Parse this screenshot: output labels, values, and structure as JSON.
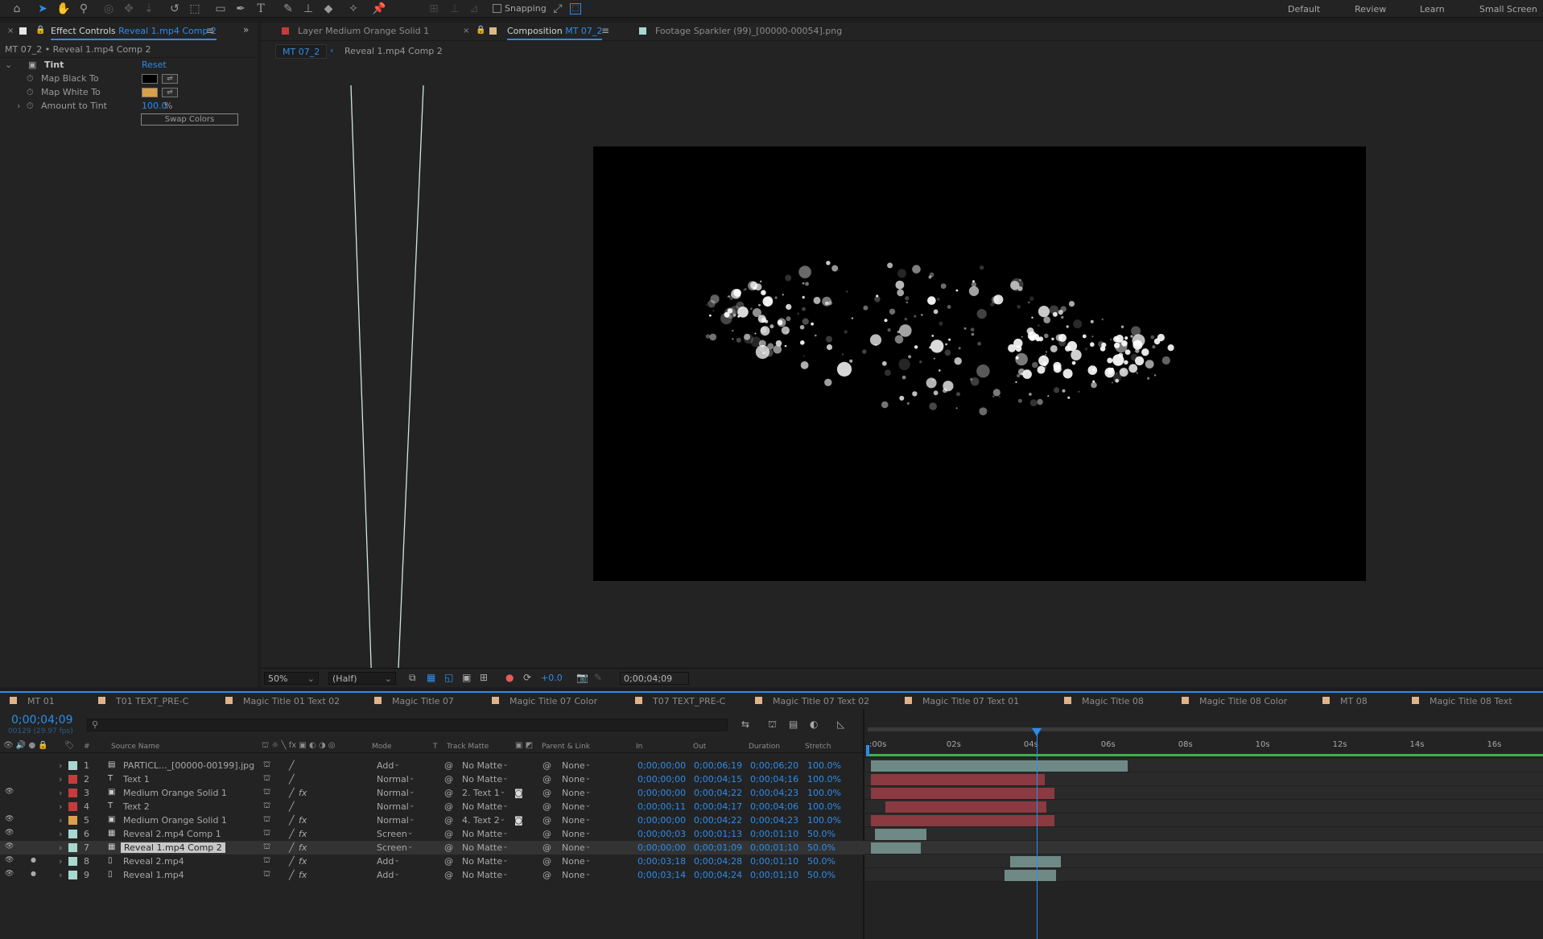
{
  "toolbar": {
    "icons": [
      "home-icon",
      "selection-tool-icon",
      "hand-tool-icon",
      "zoom-tool-icon",
      "orbit-camera-icon",
      "pan-camera-icon",
      "dolly-camera-icon",
      "rotation-tool-icon",
      "pan-behind-icon",
      "rectangle-tool-icon",
      "pen-tool-icon",
      "type-tool-icon",
      "brush-tool-icon",
      "clone-stamp-icon",
      "eraser-icon",
      "roto-brush-icon",
      "puppet-pin-icon"
    ],
    "snapping_label": "Snapping",
    "workspaces": [
      "Default",
      "Review",
      "Learn",
      "Small Screen"
    ]
  },
  "effect_controls": {
    "tab_prefix": "Effect Controls",
    "tab_layer": "Reveal 1.mp4 Comp 2",
    "breadcrumb": "MT 07_2 • Reveal 1.mp4 Comp 2",
    "effect_name": "Tint",
    "reset_label": "Reset",
    "props": [
      {
        "name": "Map Black To",
        "color": "#000000"
      },
      {
        "name": "Map White To",
        "color": "#d9a04c"
      }
    ],
    "amount_label": "Amount to Tint",
    "amount_value": "100.0",
    "amount_unit": "%",
    "swap_label": "Swap Colors"
  },
  "viewer_tabs": {
    "layer_prefix": "Layer",
    "layer_name": "Medium Orange Solid 1",
    "comp_prefix": "Composition",
    "comp_name": "MT 07_2",
    "footage_prefix": "Footage",
    "footage_name": "Sparkler (99)_[00000-00054].png",
    "flow_crumb_1": "MT 07_2",
    "flow_crumb_2": "Reveal 1.mp4 Comp 2"
  },
  "viewer_footer": {
    "zoom": "50%",
    "resolution": "(Half)",
    "exposure": "+0.0",
    "timecode": "0;00;04;09"
  },
  "timeline_tabs": [
    "MT 01",
    "T01 TEXT_PRE-C",
    "Magic Title 01 Text 02",
    "Magic Title 07",
    "Magic Title 07 Color",
    "T07 TEXT_PRE-C",
    "Magic Title 07 Text 02",
    "Magic Title 07 Text 01",
    "Magic Title 08",
    "Magic Title 08 Color",
    "MT 08",
    "Magic Title 08 Text"
  ],
  "timeline": {
    "timecode": "0;00;04;09",
    "frames_fps": "00129 (29.97 fps)",
    "search_placeholder": "",
    "headers": {
      "num": "#",
      "source": "Source Name",
      "mode": "Mode",
      "t": "T",
      "track_matte": "Track Matte",
      "parent": "Parent & Link",
      "in": "In",
      "out": "Out",
      "duration": "Duration",
      "stretch": "Stretch"
    },
    "ruler_ticks": [
      ":00s",
      "02s",
      "04s",
      "06s",
      "08s",
      "10s",
      "12s",
      "14s",
      "16s"
    ],
    "duration_seconds": 17.5,
    "current_time_seconds": 4.3,
    "layers": [
      {
        "num": "1",
        "name": "PARTICL..._[00000-00199].jpg",
        "type": "footage",
        "label": "#a7d9d0",
        "mode": "Add",
        "matte": "No Matte",
        "parent": "None",
        "in": "0;00;00;00",
        "out": "0;00;06;19",
        "duration": "0;00;06;20",
        "stretch": "100.0%",
        "bar_start": 0.0,
        "bar_end": 6.65,
        "bar_color": "#6f8a86",
        "fx": false,
        "eye": false
      },
      {
        "num": "2",
        "name": "Text 1",
        "type": "text",
        "label": "#c43c3c",
        "mode": "Normal",
        "matte": "No Matte",
        "parent": "None",
        "in": "0;00;00;00",
        "out": "0;00;04;15",
        "duration": "0;00;04;16",
        "stretch": "100.0%",
        "bar_start": 0.0,
        "bar_end": 4.5,
        "bar_color": "#8a3a40",
        "fx": false,
        "eye": false
      },
      {
        "num": "3",
        "name": "Medium Orange Solid 1",
        "type": "solid",
        "label": "#c43c3c",
        "mode": "Normal",
        "matte": "2. Text 1",
        "parent": "None",
        "in": "0;00;00;00",
        "out": "0;00;04;22",
        "duration": "0;00;04;23",
        "stretch": "100.0%",
        "bar_start": 0.0,
        "bar_end": 4.75,
        "bar_color": "#8a3a40",
        "fx": true,
        "eye": true
      },
      {
        "num": "4",
        "name": "Text 2",
        "type": "text",
        "label": "#c43c3c",
        "mode": "Normal",
        "matte": "No Matte",
        "parent": "None",
        "in": "0;00;00;11",
        "out": "0;00;04;17",
        "duration": "0;00;04;06",
        "stretch": "100.0%",
        "bar_start": 0.37,
        "bar_end": 4.55,
        "bar_color": "#8a3a40",
        "fx": false,
        "eye": false
      },
      {
        "num": "5",
        "name": "Medium Orange Solid 1",
        "type": "solid",
        "label": "#d9a04c",
        "mode": "Normal",
        "matte": "4. Text 2",
        "parent": "None",
        "in": "0;00;00;00",
        "out": "0;00;04;22",
        "duration": "0;00;04;23",
        "stretch": "100.0%",
        "bar_start": 0.0,
        "bar_end": 4.75,
        "bar_color": "#8a3a40",
        "fx": true,
        "eye": true
      },
      {
        "num": "6",
        "name": "Reveal 2.mp4 Comp 1",
        "type": "comp",
        "label": "#a7d9d0",
        "mode": "Screen",
        "matte": "No Matte",
        "parent": "None",
        "in": "0;00;00;03",
        "out": "0;00;01;13",
        "duration": "0;00;01;10",
        "stretch": "50.0%",
        "bar_start": 0.1,
        "bar_end": 1.43,
        "bar_color": "#6f8a86",
        "fx": true,
        "eye": true
      },
      {
        "num": "7",
        "name": "Reveal 1.mp4 Comp 2",
        "type": "comp",
        "label": "#a7d9d0",
        "mode": "Screen",
        "matte": "No Matte",
        "parent": "None",
        "in": "0;00;00;00",
        "out": "0;00;01;09",
        "duration": "0;00;01;10",
        "stretch": "50.0%",
        "bar_start": 0.0,
        "bar_end": 1.3,
        "bar_color": "#6f8a86",
        "fx": true,
        "eye": true,
        "selected": true
      },
      {
        "num": "8",
        "name": "Reveal 2.mp4",
        "type": "video",
        "label": "#a7d9d0",
        "mode": "Add",
        "matte": "No Matte",
        "parent": "None",
        "in": "0;00;03;18",
        "out": "0;00;04;28",
        "duration": "0;00;01;10",
        "stretch": "50.0%",
        "bar_start": 3.6,
        "bar_end": 4.93,
        "bar_color": "#6f8a86",
        "fx": true,
        "eye": true
      },
      {
        "num": "9",
        "name": "Reveal 1.mp4",
        "type": "video",
        "label": "#a7d9d0",
        "mode": "Add",
        "matte": "No Matte",
        "parent": "None",
        "in": "0;00;03;14",
        "out": "0;00;04;24",
        "duration": "0;00;01;10",
        "stretch": "50.0%",
        "bar_start": 3.47,
        "bar_end": 4.8,
        "bar_color": "#6f8a86",
        "fx": true,
        "eye": true
      }
    ]
  },
  "colors": {
    "accent": "#2d8ceb",
    "panel": "#232323",
    "bg": "#1d1d1d"
  }
}
